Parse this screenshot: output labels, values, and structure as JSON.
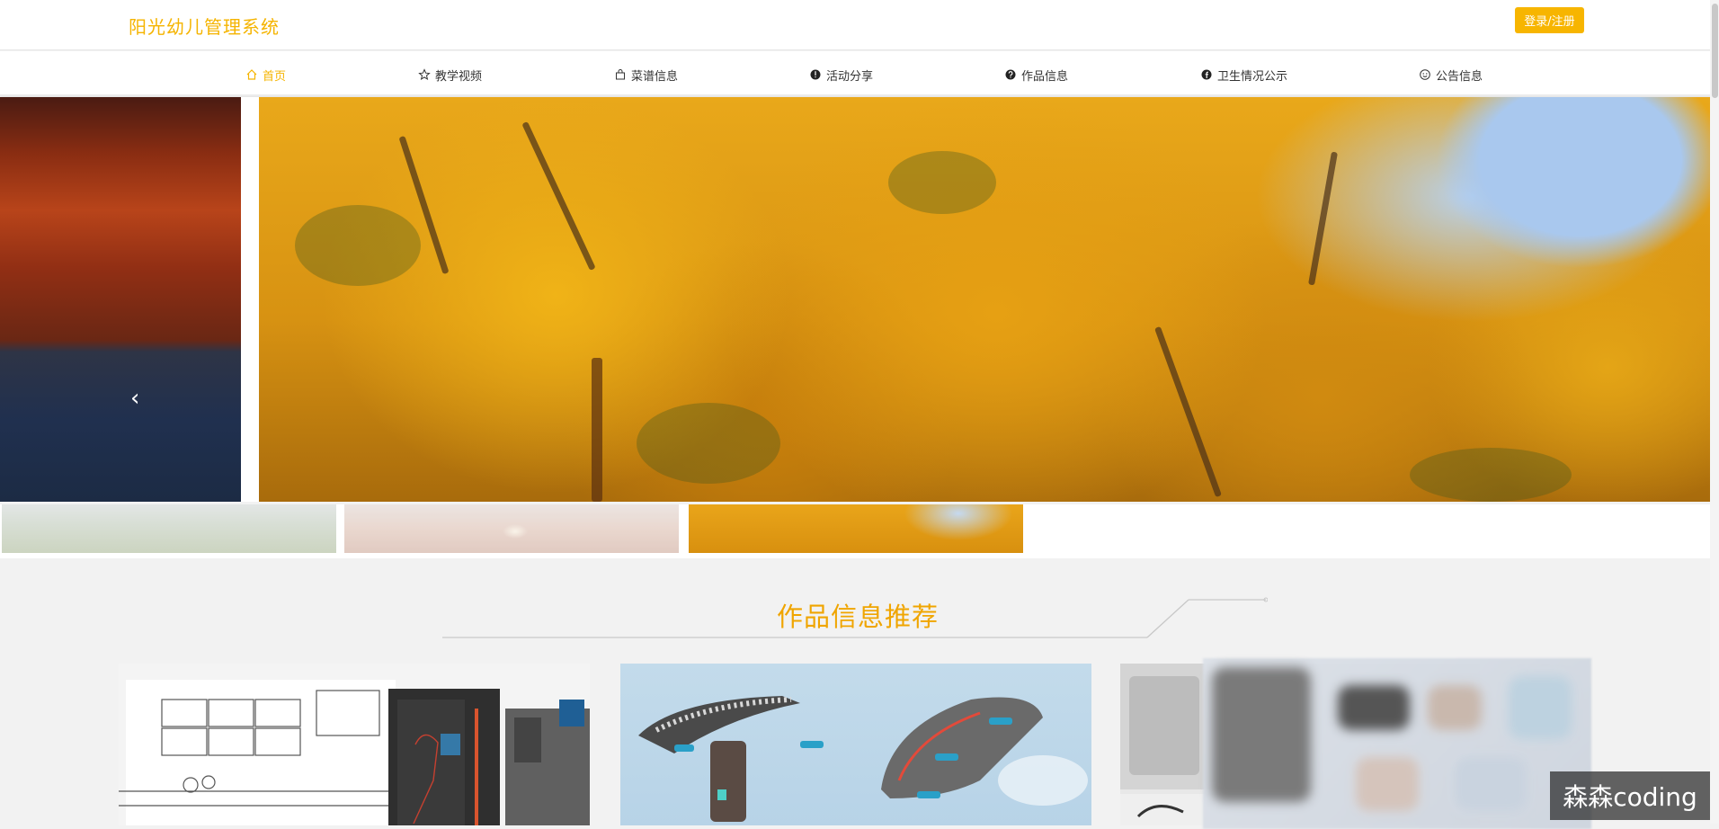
{
  "header": {
    "site_title": "阳光幼儿管理系统",
    "login_label": "登录/注册",
    "accent_color": "#f5b400"
  },
  "nav": {
    "items": [
      {
        "label": "首页",
        "icon": "home-icon",
        "active": true
      },
      {
        "label": "教学视频",
        "icon": "star-icon",
        "active": false
      },
      {
        "label": "菜谱信息",
        "icon": "bag-icon",
        "active": false
      },
      {
        "label": "活动分享",
        "icon": "info-circle-icon",
        "active": false
      },
      {
        "label": "作品信息",
        "icon": "help-circle-icon",
        "active": false
      },
      {
        "label": "卫生情况公示",
        "icon": "facebook-icon",
        "active": false
      },
      {
        "label": "公告信息",
        "icon": "face-icon",
        "active": false
      }
    ]
  },
  "carousel": {
    "prev_icon": "chevron-left-icon",
    "prev_symbol": "‹",
    "thumbnails": [
      "mountain-landscape",
      "sunset-sea",
      "autumn-trees"
    ],
    "active_thumbnail": 2
  },
  "section": {
    "title": "作品信息推荐"
  },
  "watermark": {
    "text": "森森coding"
  }
}
